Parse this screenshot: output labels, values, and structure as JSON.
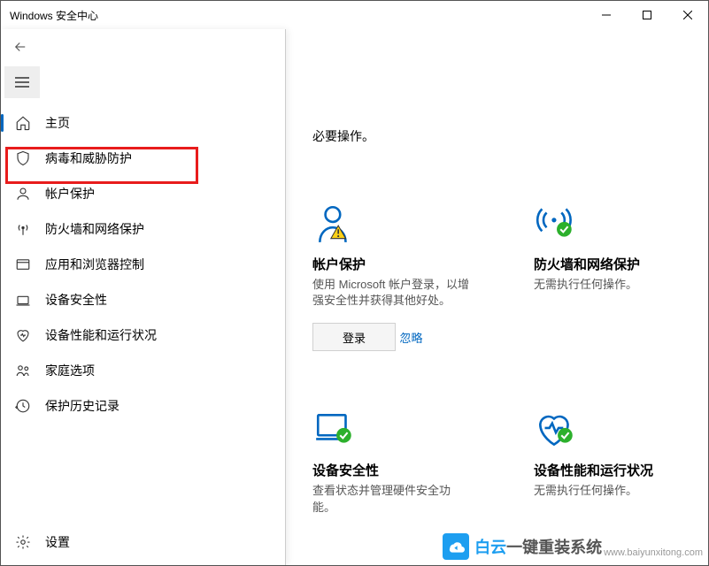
{
  "window": {
    "title": "Windows 安全中心"
  },
  "nav": {
    "home": "主页",
    "virus": "病毒和威胁防护",
    "account": "帐户保护",
    "firewall": "防火墙和网络保护",
    "app": "应用和浏览器控制",
    "device": "设备安全性",
    "perf": "设备性能和运行状况",
    "family": "家庭选项",
    "history": "保护历史记录",
    "settings": "设置"
  },
  "content": {
    "partial": "必要操作。",
    "cards": {
      "account": {
        "title": "帐户保护",
        "desc": "使用 Microsoft 帐户登录，以增强安全性并获得其他好处。",
        "button": "登录",
        "link": "忽略"
      },
      "firewall": {
        "title": "防火墙和网络保护",
        "desc": "无需执行任何操作。"
      },
      "device": {
        "title": "设备安全性",
        "desc": "查看状态并管理硬件安全功能。"
      },
      "perf": {
        "title": "设备性能和运行状况",
        "desc": "无需执行任何操作。"
      }
    }
  },
  "watermark": {
    "brand": "白云",
    "tagline": "一键重装系统",
    "url": "www.baiyunxitong.com"
  }
}
